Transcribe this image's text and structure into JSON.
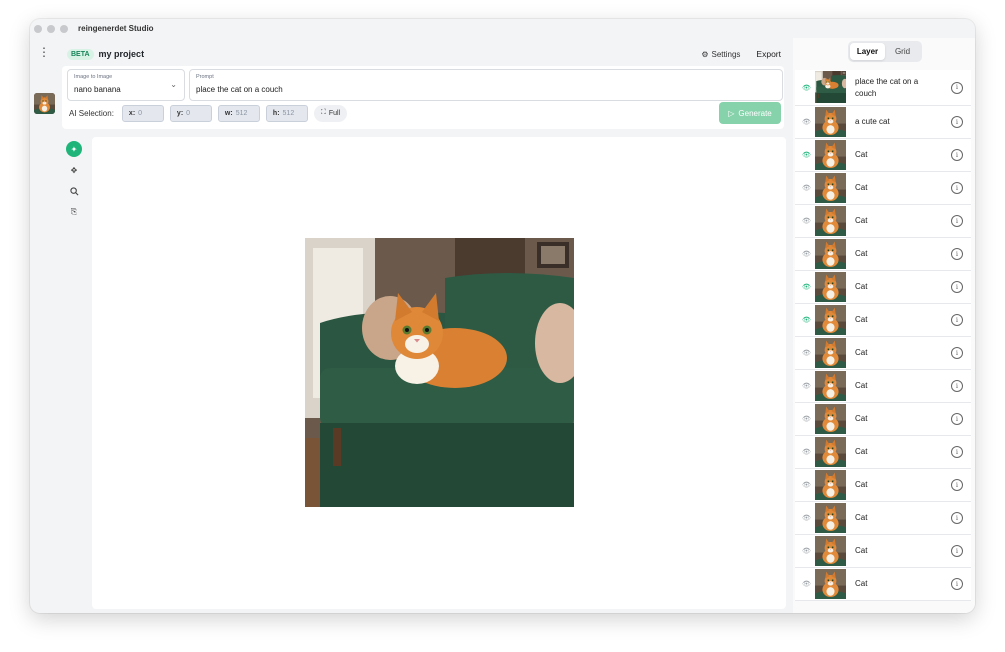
{
  "window": {
    "title": "reingenerdet Studio"
  },
  "header": {
    "beta_badge": "BETA",
    "project_name": "my project",
    "settings_label": "Settings",
    "export_label": "Export"
  },
  "toolbar": {
    "mode_label": "Image to Image",
    "mode_value": "nano banana",
    "prompt_label": "Prompt",
    "prompt_value": "place the cat on a couch",
    "ai_selection_label": "AI Selection:",
    "x": {
      "label": "x:",
      "value": "0"
    },
    "y": {
      "label": "y:",
      "value": "0"
    },
    "w": {
      "label": "w:",
      "value": "512"
    },
    "h": {
      "label": "h:",
      "value": "512"
    },
    "full_label": "Full",
    "generate_label": "Generate"
  },
  "tools": [
    "ai-tool-icon",
    "move-icon",
    "zoom-icon",
    "import-icon"
  ],
  "panel": {
    "tabs": [
      {
        "label": "Layer",
        "active": true
      },
      {
        "label": "Grid",
        "active": false
      }
    ],
    "layers": [
      {
        "name": "place the cat on a couch",
        "visible": true
      },
      {
        "name": "a cute cat",
        "visible": false
      },
      {
        "name": "Cat",
        "visible": true
      },
      {
        "name": "Cat",
        "visible": false
      },
      {
        "name": "Cat",
        "visible": false
      },
      {
        "name": "Cat",
        "visible": false
      },
      {
        "name": "Cat",
        "visible": true
      },
      {
        "name": "Cat",
        "visible": true
      },
      {
        "name": "Cat",
        "visible": false
      },
      {
        "name": "Cat",
        "visible": false
      },
      {
        "name": "Cat",
        "visible": false
      },
      {
        "name": "Cat",
        "visible": false
      },
      {
        "name": "Cat",
        "visible": false
      },
      {
        "name": "Cat",
        "visible": false
      },
      {
        "name": "Cat",
        "visible": false
      },
      {
        "name": "Cat",
        "visible": false
      }
    ]
  },
  "colors": {
    "accent": "#1fb57a",
    "generate": "#86d2ab",
    "beta_bg": "#d8f3e5"
  }
}
